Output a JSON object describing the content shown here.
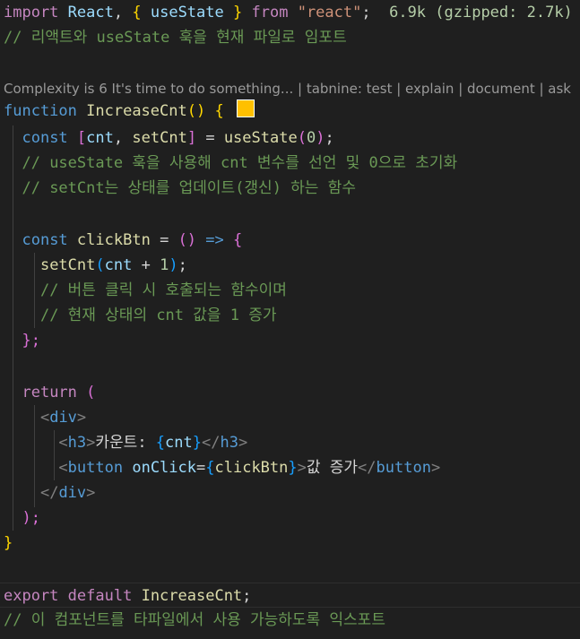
{
  "colors": {
    "background": "#1f1f1f",
    "keyword": "#c586c0",
    "storage": "#569cd6",
    "function": "#dcdcaa",
    "variable": "#9cdcfe",
    "string": "#ce9178",
    "number": "#b5cea8",
    "comment": "#6a9955",
    "color_swatch": "#ffc000"
  },
  "codelens": "Complexity is 6 It's time to do something... | tabnine: test | explain | document | ask",
  "import_line": {
    "kw_import": "import",
    "react": "React",
    "comma": ",",
    "lbrace": "{",
    "usestate": "useState",
    "rbrace": "}",
    "kw_from": "from",
    "module": "\"react\"",
    "semi": ";",
    "size_hint": "6.9k (gzipped: 2.7k)"
  },
  "comments": {
    "c1": "// 리액트와 useState 훅을 현재 파일로 임포트",
    "c2": "// useState 훅을 사용해 cnt 변수를 선언 및 0으로 초기화",
    "c3": "// setCnt는 상태를 업데이트(갱신) 하는 함수",
    "c4": "// 버튼 클릭 시 호출되는 함수이며",
    "c5": "// 현재 상태의 cnt 값을 1 증가",
    "c6": "// 이 컴포넌트를 타파일에서 사용 가능하도록 익스포트"
  },
  "func_decl": {
    "kw": "function",
    "name": "IncreaseCnt",
    "parens": "()",
    "lbrace": "{"
  },
  "state_line": {
    "kw": "const",
    "lbrack": "[",
    "cnt": "cnt",
    "comma": ",",
    "setcnt": "setCnt",
    "rbrack": "]",
    "eq": "=",
    "fn": "useState",
    "lparen": "(",
    "zero": "0",
    "rparen": ")",
    "semi": ";"
  },
  "click_decl": {
    "kw": "const",
    "name": "clickBtn",
    "eq": "=",
    "parens": "()",
    "arrow": "=>",
    "lbrace": "{"
  },
  "setcnt_call": {
    "fn": "setCnt",
    "lparen": "(",
    "arg": "cnt",
    "plus": "+",
    "one": "1",
    "rparen": ")",
    "semi": ";"
  },
  "click_close": "};",
  "return_line": {
    "kw": "return",
    "lparen": "("
  },
  "jsx": {
    "div_open": "div",
    "h3": "h3",
    "h3_text": "카운트: ",
    "expr_open": "{",
    "cnt": "cnt",
    "expr_close": "}",
    "button": "button",
    "onclick": "onClick",
    "eq": "=",
    "handler": "clickBtn",
    "button_text": "값 증가",
    "div_close": "div"
  },
  "return_close": ");",
  "func_close": "}",
  "export_line": {
    "kw_export": "export",
    "kw_default": "default",
    "name": "IncreaseCnt",
    "semi": ";"
  }
}
